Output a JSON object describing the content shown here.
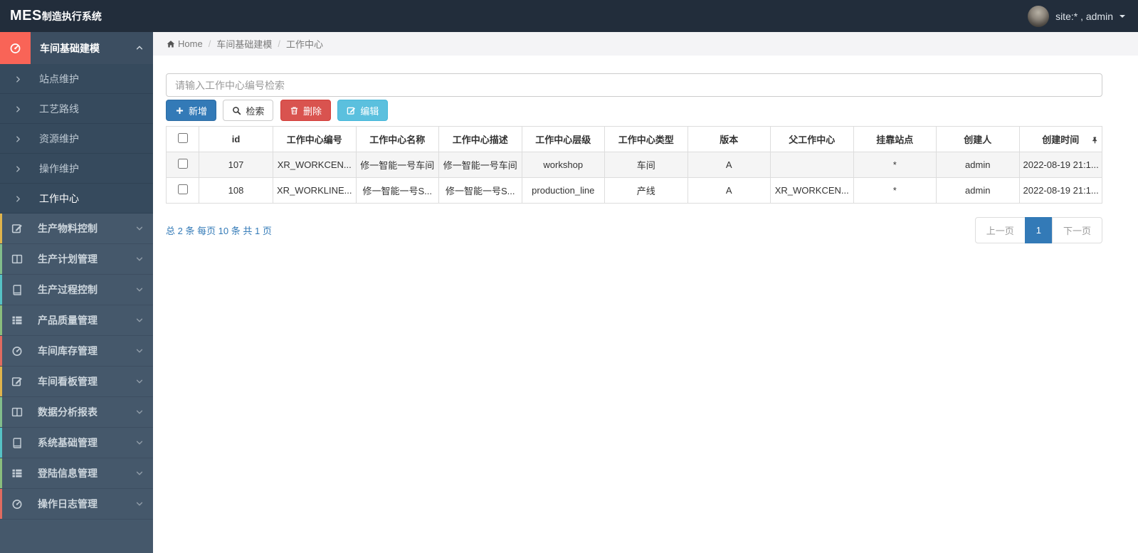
{
  "app": {
    "brand_bold": "MES",
    "brand_rest": "制造执行系统",
    "user_label": "site:* , admin"
  },
  "breadcrumb": {
    "home": "Home",
    "items": [
      "车间基础建模",
      "工作中心"
    ]
  },
  "sidebar": {
    "parent": {
      "label": "车间基础建模",
      "icon": "gauge-icon",
      "accent_color": "#f96457"
    },
    "sub_items": [
      {
        "label": "站点维护",
        "active": false
      },
      {
        "label": "工艺路线",
        "active": false
      },
      {
        "label": "资源维护",
        "active": false
      },
      {
        "label": "操作维护",
        "active": false
      },
      {
        "label": "工作中心",
        "active": true
      }
    ],
    "items": [
      {
        "label": "生产物料控制",
        "icon": "pencil-square-icon",
        "strip_color": "#e0b44c"
      },
      {
        "label": "生产计划管理",
        "icon": "columns-icon",
        "strip_color": "#82bd8b"
      },
      {
        "label": "生产过程控制",
        "icon": "book-icon",
        "strip_color": "#56c2c5"
      },
      {
        "label": "产品质量管理",
        "icon": "th-list-icon",
        "strip_color": "#8abd7d"
      },
      {
        "label": "车间库存管理",
        "icon": "gauge-icon",
        "strip_color": "#e06b60"
      },
      {
        "label": "车间看板管理",
        "icon": "pencil-square-icon",
        "strip_color": "#e0b44c"
      },
      {
        "label": "数据分析报表",
        "icon": "columns-icon",
        "strip_color": "#82bd8b"
      },
      {
        "label": "系统基础管理",
        "icon": "book-icon",
        "strip_color": "#56c2c5"
      },
      {
        "label": "登陆信息管理",
        "icon": "th-list-icon",
        "strip_color": "#8abd7d"
      },
      {
        "label": "操作日志管理",
        "icon": "gauge-icon",
        "strip_color": "#e06b60"
      }
    ]
  },
  "toolbar": {
    "search_placeholder": "请输入工作中心编号检索",
    "add_label": "新增",
    "search_label": "检索",
    "delete_label": "删除",
    "edit_label": "编辑"
  },
  "table": {
    "columns": [
      "id",
      "工作中心编号",
      "工作中心名称",
      "工作中心描述",
      "工作中心层级",
      "工作中心类型",
      "版本",
      "父工作中心",
      "挂靠站点",
      "创建人",
      "创建时间"
    ],
    "rows": [
      [
        "107",
        "XR_WORKCEN...",
        "修一智能一号车间",
        "修一智能一号车间",
        "workshop",
        "车间",
        "A",
        "",
        "*",
        "admin",
        "2022-08-19 21:1..."
      ],
      [
        "108",
        "XR_WORKLINE...",
        "修一智能一号S...",
        "修一智能一号S...",
        "production_line",
        "产线",
        "A",
        "XR_WORKCEN...",
        "*",
        "admin",
        "2022-08-19 21:1..."
      ]
    ]
  },
  "pagination": {
    "summary": "总 2 条 每页 10 条 共 1 页",
    "prev_label": "上一页",
    "current_page": "1",
    "next_label": "下一页"
  },
  "colors": {
    "navbar_bg": "#222d3b",
    "sidebar_bg": "#45586b",
    "submenu_bg": "#364a5d",
    "active_accent": "#f96457",
    "primary": "#337ab7",
    "danger": "#d9534f",
    "info": "#5bc0de"
  }
}
